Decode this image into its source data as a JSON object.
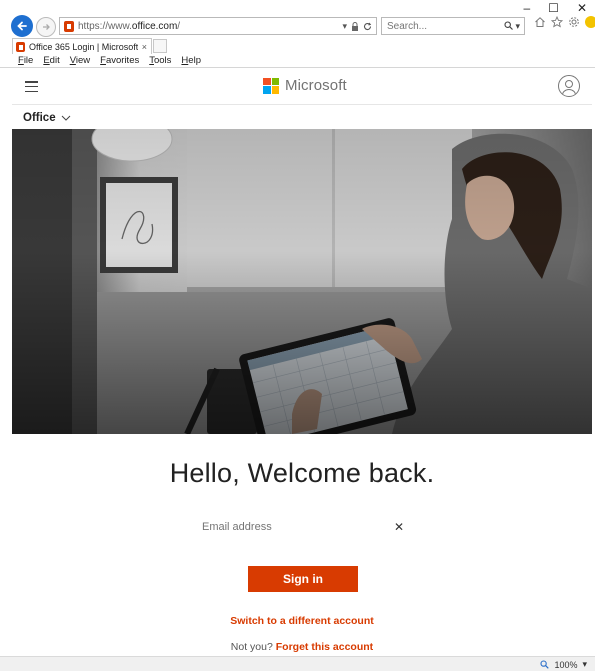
{
  "browser": {
    "window_controls": {
      "minimize": "–",
      "maximize": "☐",
      "close": "✕"
    },
    "url_scheme": "https://www.",
    "url_host": "office.com",
    "url_path": "/",
    "search_placeholder": "Search...",
    "tab_title": "Office 365 Login | Microsoft...",
    "tab_close": "×",
    "menu": [
      "File",
      "Edit",
      "View",
      "Favorites",
      "Tools",
      "Help"
    ],
    "zoom": "100%"
  },
  "header": {
    "brand": "Microsoft"
  },
  "office_nav": {
    "label": "Office"
  },
  "login": {
    "welcome": "Hello, Welcome back.",
    "email_placeholder": "Email address",
    "clear_icon": "✕",
    "signin_label": "Sign in",
    "switch_account": "Switch to a different account",
    "not_you": "Not you?",
    "forget_account": "Forget this account"
  },
  "colors": {
    "accent": "#d83b01",
    "ms_red": "#f25022",
    "ms_green": "#7fba00",
    "ms_blue": "#00a4ef",
    "ms_yellow": "#ffb900"
  }
}
